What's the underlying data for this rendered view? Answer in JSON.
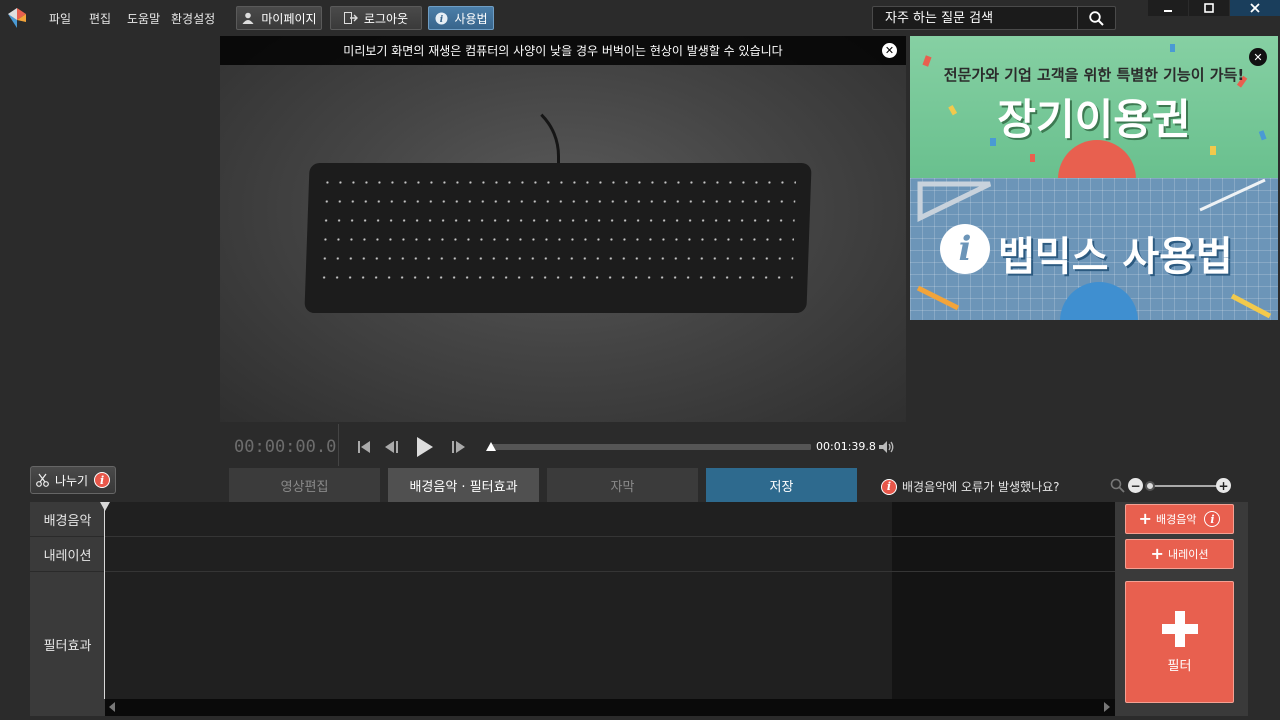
{
  "menu": {
    "file": "파일",
    "edit": "편집",
    "help": "도움말",
    "settings": "환경설정"
  },
  "toolbar": {
    "mypage": "마이페이지",
    "logout": "로그아웃",
    "howto": "사용법"
  },
  "search": {
    "placeholder": "자주 하는 질문 검색"
  },
  "preview": {
    "notice": "미리보기 화면의 재생은 컴퓨터의 사양이 낮을 경우 버벅이는 현상이 발생할 수 있습니다"
  },
  "ads": {
    "ad1_subtitle": "전문가와 기업 고객을 위한 특별한 기능이 가득!",
    "ad1_title": "장기이용권",
    "ad2_title": "뱁믹스 사용법"
  },
  "player": {
    "current_time": "00:00:00.0",
    "total_time": "00:01:39.8",
    "progress": 0.0
  },
  "editor": {
    "split_label": "나누기",
    "tabs": [
      "영상편집",
      "배경음악 · 필터효과",
      "자막",
      "저장"
    ],
    "bgm_error_text": "배경음악에 오류가 발생했나요?"
  },
  "timeline": {
    "tracks": [
      "배경음악",
      "내레이션",
      "필터효과"
    ]
  },
  "add_panel": {
    "bgm": "배경음악",
    "narration": "내레이션",
    "filter": "필터"
  },
  "colors": {
    "accent_blue": "#2e6a8e",
    "add_red": "#e8604f",
    "ad_green": "#69c08e",
    "ad_blue": "#6c95b8"
  }
}
